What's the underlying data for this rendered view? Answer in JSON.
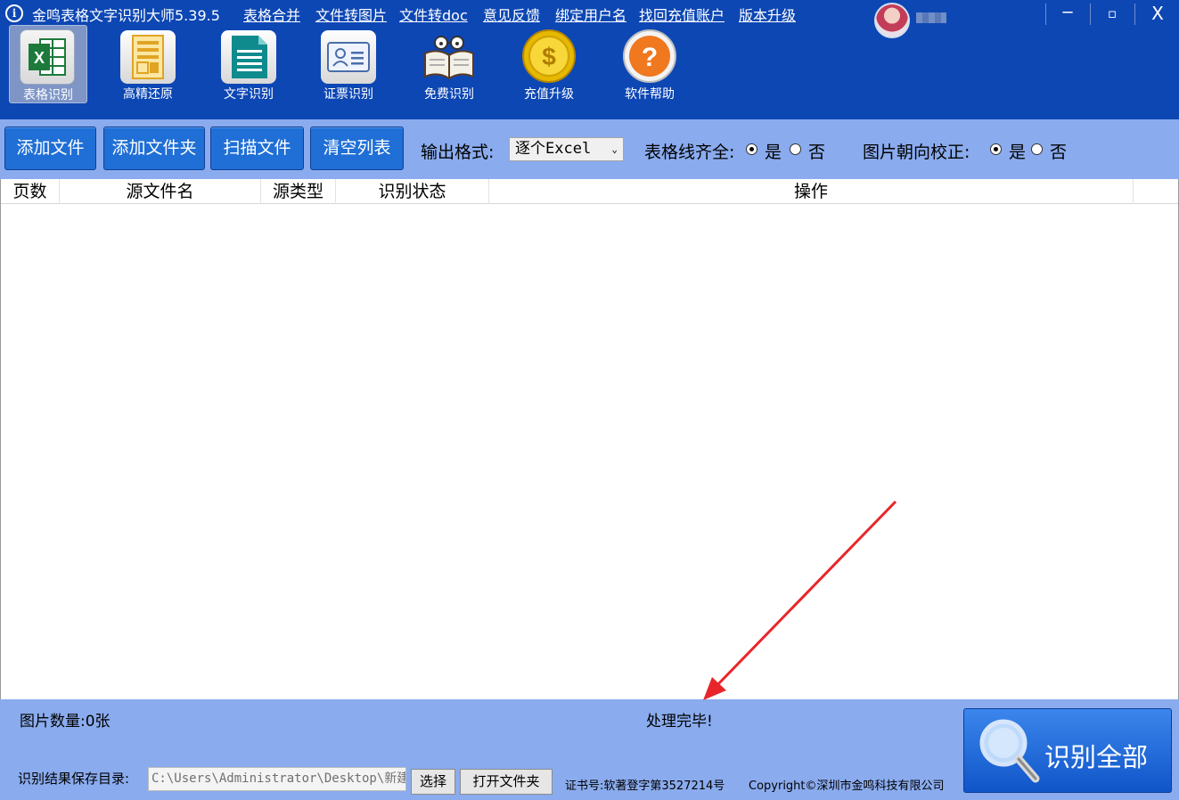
{
  "window": {
    "title": "金鸣表格文字识别大师5.39.5",
    "menu": [
      "表格合并",
      "文件转图片",
      "文件转doc",
      "意见反馈",
      "绑定用户名",
      "找回充值账户",
      "版本升级"
    ],
    "controls": {
      "minimize": "─",
      "maximize": "▫",
      "close": "X"
    }
  },
  "toolbar": {
    "items": [
      {
        "label": "表格识别",
        "icon": "excel-icon",
        "active": true
      },
      {
        "label": "高精还原",
        "icon": "document-layout-icon"
      },
      {
        "label": "文字识别",
        "icon": "text-document-icon"
      },
      {
        "label": "证票识别",
        "icon": "id-card-icon"
      },
      {
        "label": "免费识别",
        "icon": "book-glasses-icon"
      },
      {
        "label": "充值升级",
        "icon": "gold-coin-icon"
      },
      {
        "label": "软件帮助",
        "icon": "help-icon"
      }
    ]
  },
  "actions": {
    "add_file": "添加文件",
    "add_folder": "添加文件夹",
    "scan_file": "扫描文件",
    "clear_list": "清空列表",
    "output_format_label": "输出格式:",
    "output_format_value": "逐个Excel",
    "table_lines_label": "表格线齐全:",
    "orientation_label": "图片朝向校正:",
    "yes": "是",
    "no": "否",
    "table_lines_selected": "yes",
    "orientation_selected": "yes"
  },
  "table": {
    "columns": [
      "页数",
      "源文件名",
      "源类型",
      "识别状态",
      "操作"
    ],
    "rows": []
  },
  "status": {
    "image_count": "图片数量:0张",
    "message": "处理完毕!",
    "save_dir_label": "识别结果保存目录:",
    "save_dir_value": "C:\\Users\\Administrator\\Desktop\\新建",
    "select_button": "选择",
    "open_folder_button": "打开文件夹",
    "cert": "证书号:软著登字第3527214号",
    "copyright": "Copyright©深圳市金鸣科技有限公司",
    "recognize_all": "识别全部"
  },
  "colors": {
    "titlebar": "#0d47b4",
    "panel": "#8aabee",
    "button": "#1f6fd6",
    "annotation_arrow": "#e8262a"
  }
}
